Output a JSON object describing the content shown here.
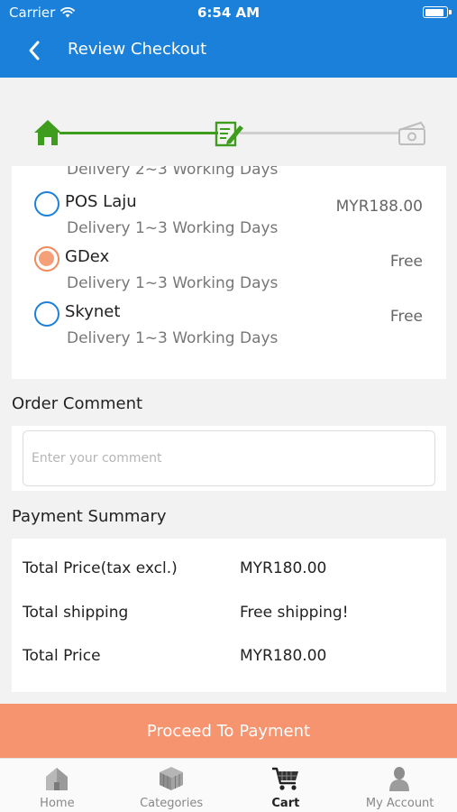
{
  "status_bar": {
    "carrier": "Carrier",
    "time": "6:54 AM",
    "battery_level": 0.95
  },
  "header": {
    "title": "Review Checkout"
  },
  "checkout_steps": {
    "active_step": 2,
    "total_steps": 3
  },
  "shipping": {
    "partial_desc": "Delivery 2~3 Working Days",
    "options": [
      {
        "name": "POS Laju",
        "price": "MYR188.00",
        "desc": "Delivery 1~3 Working Days",
        "selected": false
      },
      {
        "name": "GDex",
        "price": "Free",
        "desc": "Delivery 1~3 Working Days",
        "selected": true
      },
      {
        "name": "Skynet",
        "price": "Free",
        "desc": "Delivery 1~3 Working Days",
        "selected": false
      }
    ]
  },
  "order_comment": {
    "label": "Order Comment",
    "placeholder": "Enter your comment",
    "value": ""
  },
  "payment_summary": {
    "label": "Payment Summary",
    "rows": [
      {
        "key": "Total Price(tax excl.)",
        "value": "MYR180.00"
      },
      {
        "key": "Total shipping",
        "value": "Free shipping!"
      },
      {
        "key": "Total Price",
        "value": "MYR180.00"
      }
    ]
  },
  "proceed_button": {
    "label": "Proceed To Payment"
  },
  "tab_bar": {
    "tabs": [
      {
        "label": "Home",
        "icon": "home-icon",
        "active": false
      },
      {
        "label": "Categories",
        "icon": "cube-icon",
        "active": false
      },
      {
        "label": "Cart",
        "icon": "cart-icon",
        "active": true
      },
      {
        "label": "My Account",
        "icon": "user-icon",
        "active": false
      }
    ]
  },
  "colors": {
    "brand_blue": "#1a80d9",
    "progress_green": "#3f9d1e",
    "accent_orange": "#f69470"
  }
}
